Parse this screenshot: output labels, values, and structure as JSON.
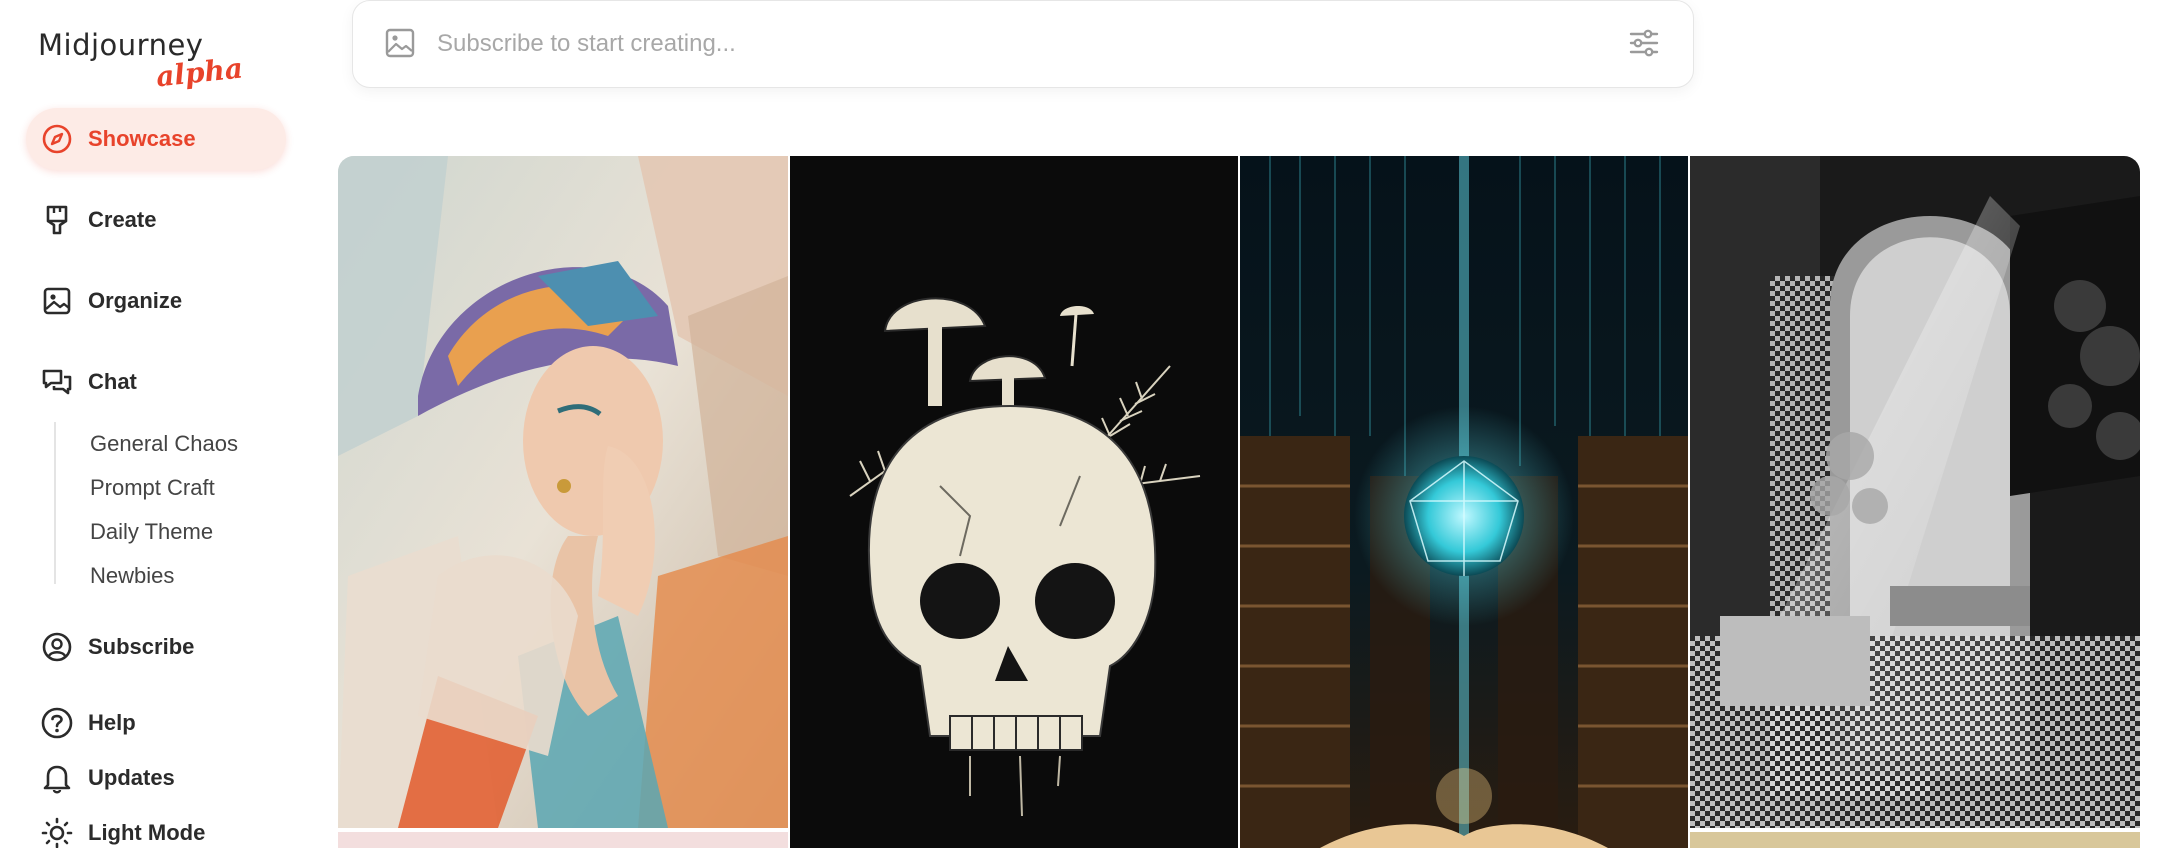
{
  "app": {
    "logo_main": "Midjourney",
    "logo_sub": "alpha",
    "accent_color": "#e8432b"
  },
  "sidebar": {
    "items": [
      {
        "label": "Showcase",
        "icon": "compass-icon",
        "active": true
      },
      {
        "label": "Create",
        "icon": "brush-icon"
      },
      {
        "label": "Organize",
        "icon": "image-icon"
      },
      {
        "label": "Chat",
        "icon": "chat-bubbles-icon"
      }
    ],
    "chat_channels": [
      "General Chaos",
      "Prompt Craft",
      "Daily Theme",
      "Newbies"
    ],
    "bottom_items": [
      {
        "label": "Subscribe",
        "icon": "user-circle-icon"
      },
      {
        "label": "Help",
        "icon": "question-circle-icon"
      },
      {
        "label": "Updates",
        "icon": "bell-icon"
      },
      {
        "label": "Light Mode",
        "icon": "sun-icon"
      }
    ]
  },
  "search": {
    "placeholder": "Subscribe to start creating...",
    "left_icon": "image-icon",
    "right_icon": "sliders-icon"
  },
  "gallery": {
    "images": [
      {
        "subject": "abstract-woman-portrait"
      },
      {
        "subject": "skull-with-mushrooms"
      },
      {
        "subject": "glowing-orb-library"
      },
      {
        "subject": "monochrome-arch-light"
      }
    ]
  }
}
